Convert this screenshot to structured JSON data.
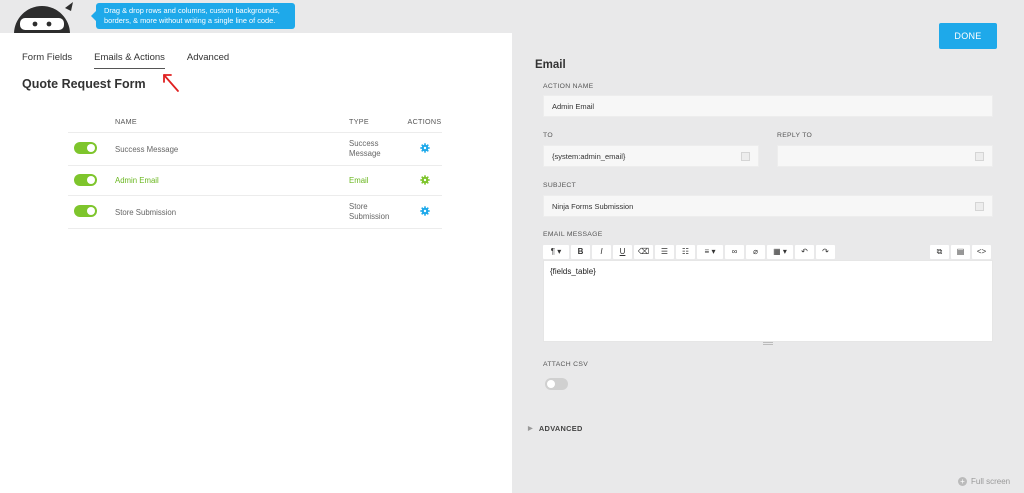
{
  "tooltip": {
    "line1": "Drag & drop rows and columns, custom backgrounds,",
    "line2": "borders, & more without writing a single line of code."
  },
  "tabs": [
    {
      "label": "Form Fields"
    },
    {
      "label": "Emails & Actions"
    },
    {
      "label": "Advanced"
    }
  ],
  "form_title": "Quote Request Form",
  "table": {
    "headers": {
      "name": "NAME",
      "type": "TYPE",
      "actions": "ACTIONS"
    },
    "rows": [
      {
        "name": "Success Message",
        "type": "Success Message",
        "enabled": true
      },
      {
        "name": "Admin Email",
        "type": "Email",
        "enabled": true
      },
      {
        "name": "Store Submission",
        "type": "Store Submission",
        "enabled": true
      }
    ]
  },
  "done_label": "DONE",
  "panel": {
    "title": "Email",
    "action_name_label": "ACTION NAME",
    "action_name_value": "Admin Email",
    "to_label": "TO",
    "to_value": "{system:admin_email}",
    "reply_to_label": "REPLY TO",
    "reply_to_value": "",
    "subject_label": "SUBJECT",
    "subject_value": "Ninja Forms Submission",
    "email_message_label": "EMAIL MESSAGE",
    "email_message_value": "{fields_table}",
    "attach_csv_label": "ATTACH CSV",
    "advanced_label": "ADVANCED"
  },
  "fullscreen_label": "Full screen",
  "colors": {
    "accent_blue": "#1ea9ea",
    "toggle_green": "#7ec52c",
    "highlight_green": "#6ab720",
    "arrow_red": "#e02020"
  },
  "icons": [
    "ninja-logo-icon",
    "gear-icon",
    "paragraph-icon",
    "bold-icon",
    "italic-icon",
    "underline-icon",
    "eraser-icon",
    "ordered-list-icon",
    "unordered-list-icon",
    "align-icon",
    "link-icon",
    "unlink-icon",
    "table-icon",
    "undo-icon",
    "redo-icon",
    "merge-tags-icon",
    "code-icon",
    "plus-circle-icon"
  ]
}
